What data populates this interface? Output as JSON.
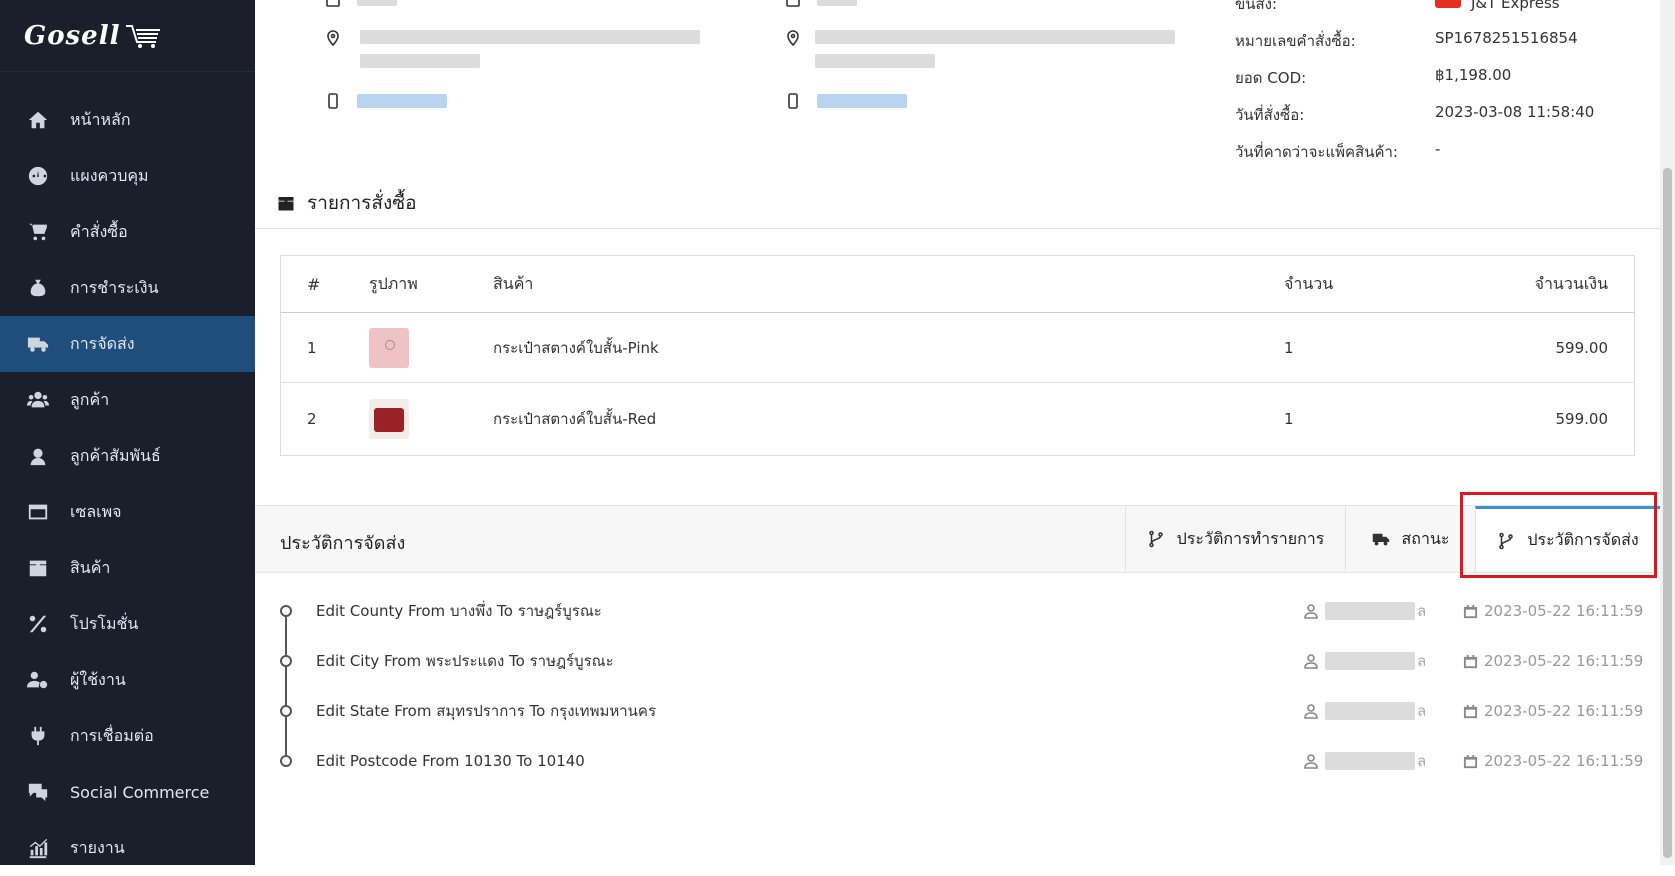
{
  "app": {
    "logo": "Gosell"
  },
  "sidebar": {
    "items": [
      {
        "label": "หน้าหลัก",
        "icon": "home-icon",
        "active": false
      },
      {
        "label": "แผงควบคุม",
        "icon": "dashboard-icon",
        "active": false
      },
      {
        "label": "คำสั่งซื้อ",
        "icon": "cart-icon",
        "active": false
      },
      {
        "label": "การชำระเงิน",
        "icon": "money-bag-icon",
        "active": false
      },
      {
        "label": "การจัดส่ง",
        "icon": "truck-icon",
        "active": true
      },
      {
        "label": "ลูกค้า",
        "icon": "users-icon",
        "active": false
      },
      {
        "label": "ลูกค้าสัมพันธ์",
        "icon": "headset-icon",
        "active": false
      },
      {
        "label": "เซลเพจ",
        "icon": "window-icon",
        "active": false
      },
      {
        "label": "สินค้า",
        "icon": "box-icon",
        "active": false
      },
      {
        "label": "โปรโมชั่น",
        "icon": "percent-icon",
        "active": false
      },
      {
        "label": "ผู้ใช้งาน",
        "icon": "users-cog-icon",
        "active": false
      },
      {
        "label": "การเชื่อมต่อ",
        "icon": "plug-icon",
        "active": false
      },
      {
        "label": "Social Commerce",
        "icon": "chat-dollar-icon",
        "active": false
      },
      {
        "label": "รายงาน",
        "icon": "chart-icon",
        "active": false
      }
    ]
  },
  "order_info": {
    "carrier_label": "ขนส่ง:",
    "carrier_value": "J&T Express",
    "order_number_label": "หมายเลขคำสั่งซื้อ:",
    "order_number": "SP1678251516854",
    "cod_label": "ยอด COD:",
    "cod_value": "฿1,198.00",
    "order_date_label": "วันที่สั่งซื้อ:",
    "order_date": "2023-03-08 11:58:40",
    "pack_date_label": "วันที่คาดว่าจะแพ็คสินค้า:",
    "pack_date": "-"
  },
  "order_items": {
    "title": "รายการสั่งซื้อ",
    "headers": {
      "num": "#",
      "image": "รูปภาพ",
      "product": "สินค้า",
      "qty": "จำนวน",
      "amount": "จำนวนเงิน"
    },
    "rows": [
      {
        "num": "1",
        "product": "กระเป๋าสตางค์ใบสั้น-Pink",
        "qty": "1",
        "amount": "599.00"
      },
      {
        "num": "2",
        "product": "กระเป๋าสตางค์ใบสั้น-Red",
        "qty": "1",
        "amount": "599.00"
      }
    ]
  },
  "history": {
    "title": "ประวัติการจัดส่ง",
    "tabs": [
      {
        "label": "ประวัติการทำรายการ",
        "icon": "branch-icon"
      },
      {
        "label": "สถานะ",
        "icon": "truck-icon"
      },
      {
        "label": "ประวัติการจัดส่ง",
        "icon": "branch-icon",
        "active": true
      }
    ],
    "entries": [
      {
        "text": "Edit County From บางพึ่ง To ราษฎร์บูรณะ",
        "user_suffix": "ล",
        "date": "2023-05-22 16:11:59"
      },
      {
        "text": "Edit City From พระประแดง To ราษฎร์บูรณะ",
        "user_suffix": "ล",
        "date": "2023-05-22 16:11:59"
      },
      {
        "text": "Edit State From สมุทรปราการ To กรุงเทพมหานคร",
        "user_suffix": "ล",
        "date": "2023-05-22 16:11:59"
      },
      {
        "text": "Edit Postcode From 10130 To 10140",
        "user_suffix": "ล",
        "date": "2023-05-22 16:11:59"
      }
    ]
  },
  "colors": {
    "sidebar_bg": "#1a1f2b",
    "active_bg": "#1f4e7d",
    "accent": "#3b8fd9",
    "highlight": "#e0161c"
  }
}
